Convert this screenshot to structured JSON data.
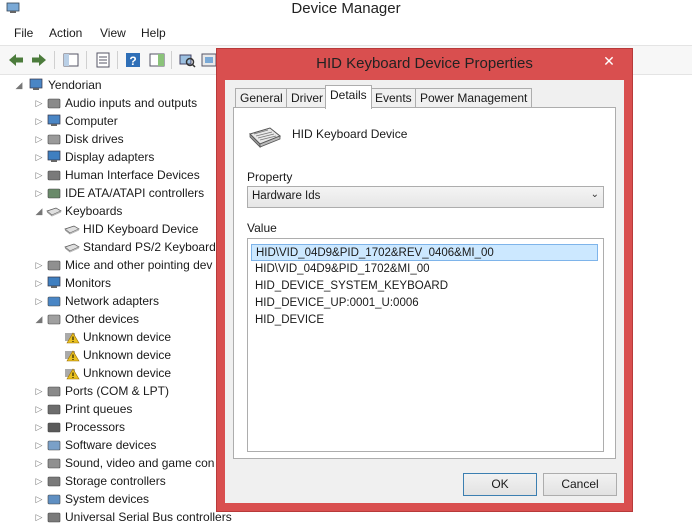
{
  "window": {
    "title": "Device Manager"
  },
  "menu": [
    "File",
    "Action",
    "View",
    "Help"
  ],
  "tree": {
    "root": "Yendorian",
    "items": [
      {
        "label": "Audio inputs and outputs",
        "icon": "speaker-icon",
        "expanded": false
      },
      {
        "label": "Computer",
        "icon": "computer-icon",
        "expanded": false
      },
      {
        "label": "Disk drives",
        "icon": "disk-drive-icon",
        "expanded": false
      },
      {
        "label": "Display adapters",
        "icon": "display-adapter-icon",
        "expanded": false
      },
      {
        "label": "Human Interface Devices",
        "icon": "hid-icon",
        "expanded": false
      },
      {
        "label": "IDE ATA/ATAPI controllers",
        "icon": "ide-controller-icon",
        "expanded": false
      },
      {
        "label": "Keyboards",
        "icon": "keyboard-icon",
        "expanded": true,
        "children": [
          {
            "label": "HID Keyboard Device",
            "icon": "keyboard-icon"
          },
          {
            "label": "Standard PS/2 Keyboard",
            "icon": "keyboard-icon"
          }
        ]
      },
      {
        "label": "Mice and other pointing dev",
        "icon": "mouse-icon",
        "expanded": false
      },
      {
        "label": "Monitors",
        "icon": "monitor-icon",
        "expanded": false
      },
      {
        "label": "Network adapters",
        "icon": "network-adapter-icon",
        "expanded": false
      },
      {
        "label": "Other devices",
        "icon": "other-devices-icon",
        "expanded": true,
        "children": [
          {
            "label": "Unknown device",
            "icon": "warning-icon"
          },
          {
            "label": "Unknown device",
            "icon": "warning-icon"
          },
          {
            "label": "Unknown device",
            "icon": "warning-icon"
          }
        ]
      },
      {
        "label": "Ports (COM & LPT)",
        "icon": "port-icon",
        "expanded": false
      },
      {
        "label": "Print queues",
        "icon": "printer-icon",
        "expanded": false
      },
      {
        "label": "Processors",
        "icon": "processor-icon",
        "expanded": false
      },
      {
        "label": "Software devices",
        "icon": "software-device-icon",
        "expanded": false
      },
      {
        "label": "Sound, video and game con",
        "icon": "sound-icon",
        "expanded": false
      },
      {
        "label": "Storage controllers",
        "icon": "storage-controller-icon",
        "expanded": false
      },
      {
        "label": "System devices",
        "icon": "system-device-icon",
        "expanded": false
      },
      {
        "label": "Universal Serial Bus controllers",
        "icon": "usb-icon",
        "expanded": false
      }
    ]
  },
  "dialog": {
    "title": "HID Keyboard Device Properties",
    "close_label": "✕",
    "tabs": [
      "General",
      "Driver",
      "Details",
      "Events",
      "Power Management"
    ],
    "active_tab": "Details",
    "device_name": "HID Keyboard Device",
    "property_label": "Property",
    "property_value": "Hardware Ids",
    "value_label": "Value",
    "values": [
      "HID\\VID_04D9&PID_1702&REV_0406&MI_00",
      "HID\\VID_04D9&PID_1702&MI_00",
      "HID_DEVICE_SYSTEM_KEYBOARD",
      "HID_DEVICE_UP:0001_U:0006",
      "HID_DEVICE"
    ],
    "selected_value_index": 0,
    "ok_label": "OK",
    "cancel_label": "Cancel"
  },
  "colors": {
    "dialog_frame": "#d94f4f",
    "selection": "#cce8ff"
  }
}
